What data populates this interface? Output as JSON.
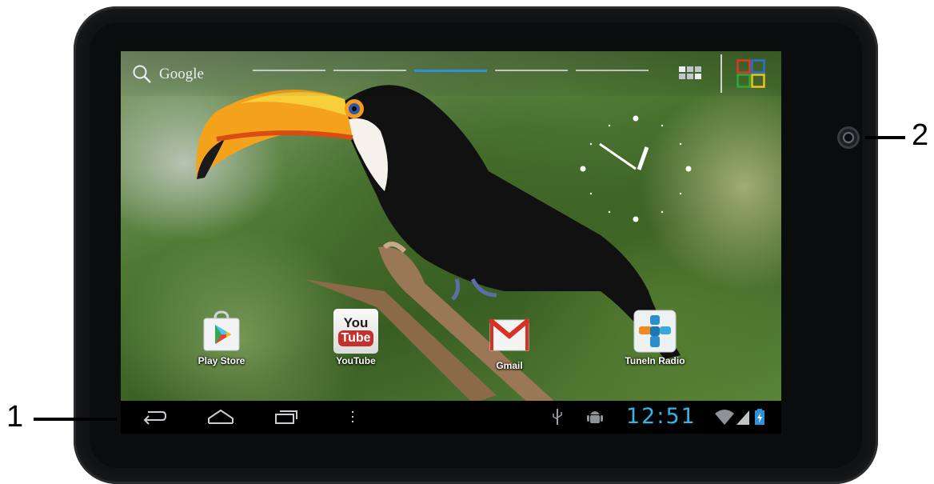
{
  "search": {
    "label": "Google"
  },
  "apps": [
    {
      "name": "Play Store"
    },
    {
      "name": "YouTube",
      "icon_line1": "You",
      "icon_line2": "Tube"
    },
    {
      "name": "Gmail"
    },
    {
      "name": "TuneIn Radio"
    }
  ],
  "status": {
    "time": "12:51"
  },
  "callouts": {
    "left": "1",
    "right": "2"
  },
  "colors": {
    "accent": "#33b5e5",
    "page_indicator_active": "#2e93d6",
    "device": "#111214"
  },
  "pages": {
    "count": 5,
    "active_index": 2
  },
  "icons": [
    "search-icon",
    "widget-grid-icon",
    "all-apps-icon",
    "back-icon",
    "home-icon",
    "recent-apps-icon",
    "menu-icon",
    "usb-icon",
    "android-debug-icon",
    "wifi-icon",
    "signal-icon",
    "battery-icon",
    "camera"
  ]
}
